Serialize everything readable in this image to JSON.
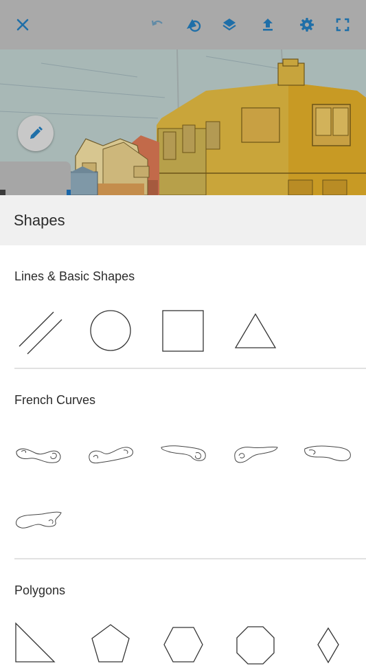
{
  "toolbar": {
    "buttons": [
      {
        "name": "close-button",
        "icon": "close-icon"
      },
      {
        "name": "undo-button",
        "icon": "undo-icon"
      },
      {
        "name": "shapes-tool-button",
        "icon": "shapes-tool-icon"
      },
      {
        "name": "layers-button",
        "icon": "layers-icon"
      },
      {
        "name": "export-button",
        "icon": "upload-icon"
      },
      {
        "name": "settings-button",
        "icon": "gear-icon"
      },
      {
        "name": "fullscreen-button",
        "icon": "fullscreen-icon"
      }
    ],
    "accent_color": "#1f6fa8"
  },
  "canvas": {
    "content": "line-art illustration of colored street buildings"
  },
  "panel": {
    "title": "Shapes",
    "sections": [
      {
        "title": "Lines & Basic Shapes",
        "items": [
          "parallel-lines",
          "circle",
          "square",
          "triangle"
        ]
      },
      {
        "title": "French Curves",
        "items": [
          "french-curve-1",
          "french-curve-2",
          "french-curve-3",
          "french-curve-4",
          "french-curve-5",
          "french-curve-6"
        ]
      },
      {
        "title": "Polygons",
        "items": [
          "right-triangle",
          "pentagon",
          "hexagon",
          "octagon",
          "diamond"
        ]
      }
    ]
  }
}
